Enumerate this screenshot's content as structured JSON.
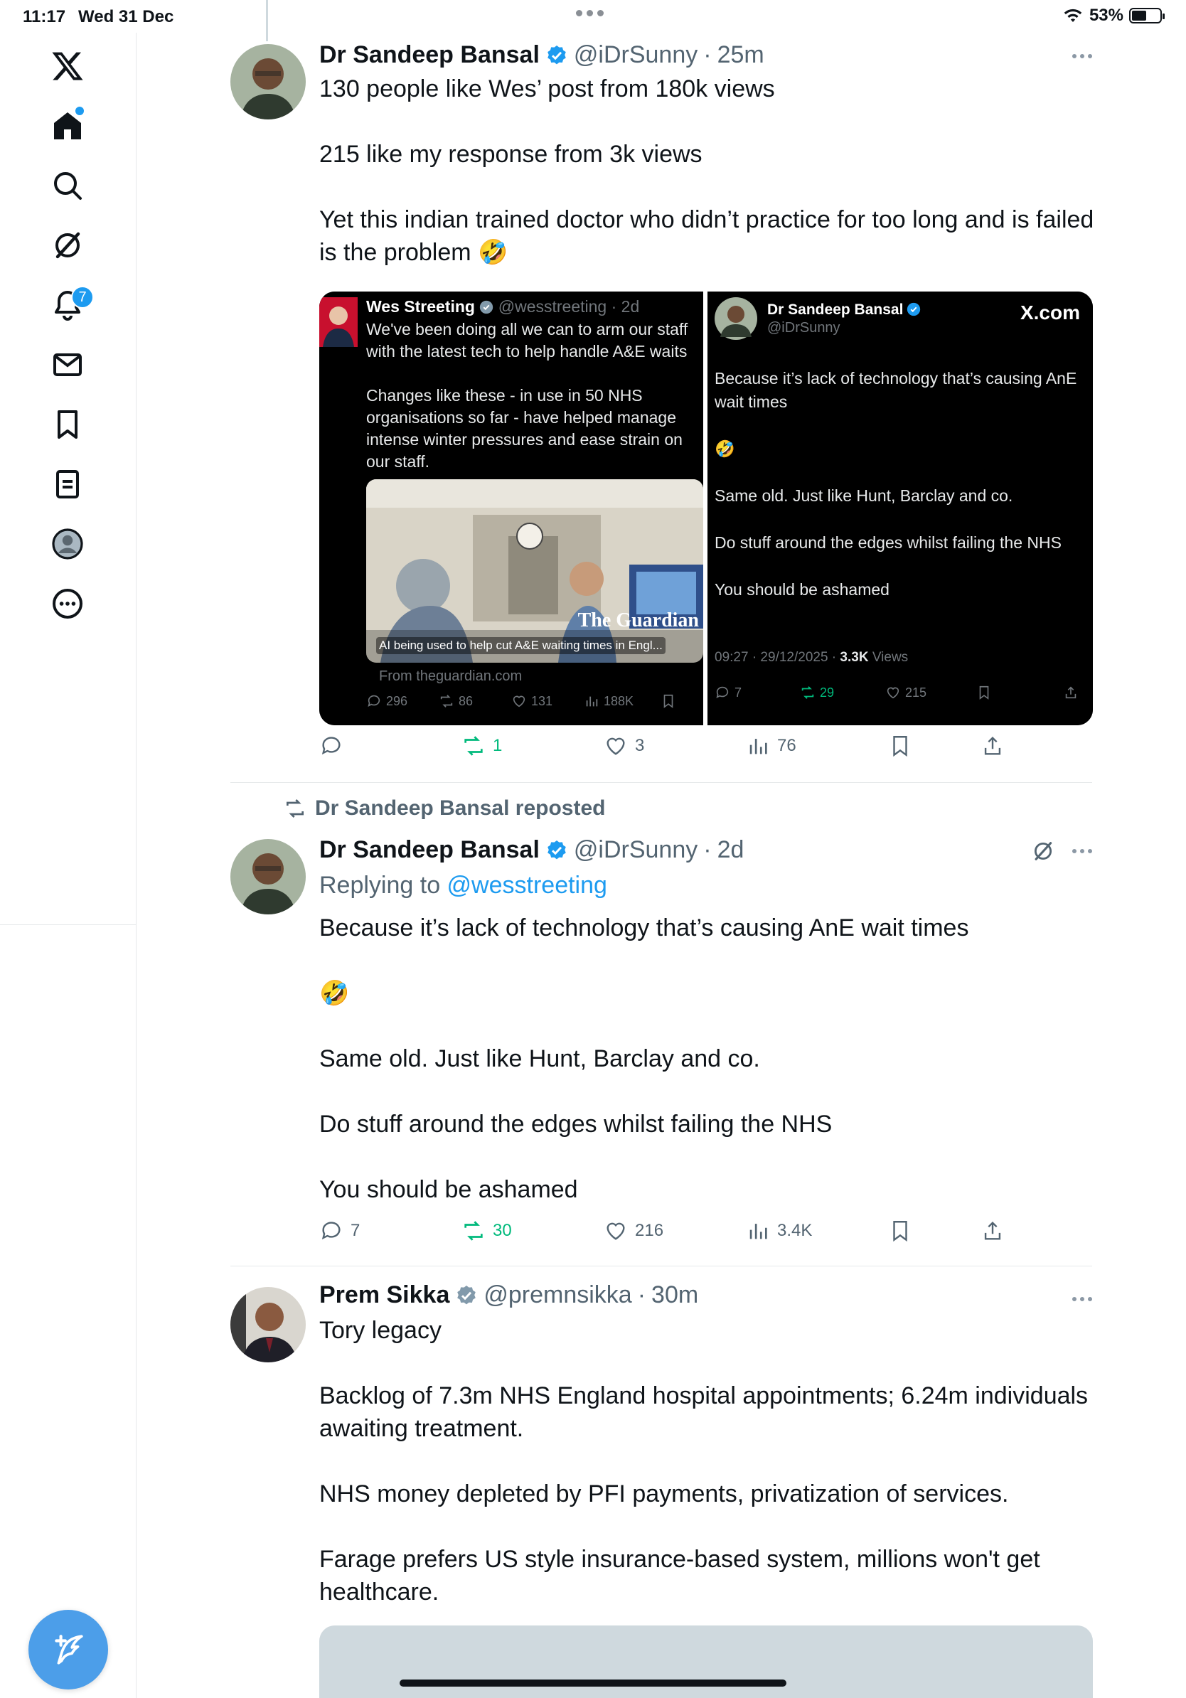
{
  "status_bar": {
    "time": "11:17",
    "date": "Wed 31 Dec",
    "battery": "53%"
  },
  "sidebar": {
    "notifications_badge": "7"
  },
  "posts": [
    {
      "name": "Dr Sandeep Bansal",
      "handle": "@iDrSunny",
      "time": "25m",
      "text": "130 people like Wes’ post from 180k views\n\n215 like my response from 3k views\n\nYet this indian trained doctor who didn’t practice for too long and is failed is the problem 🤣",
      "quote": {
        "left": {
          "name": "Wes Streeting",
          "handle": "@wesstreeting",
          "time": "2d",
          "text": "We've been doing all we can to arm our staff with the latest tech to help handle A&E waits\n\nChanges like these - in use in 50 NHS organisations so far - have helped manage intense winter pressures and ease strain on our staff.",
          "image_caption": "AI being used to help cut A&E waiting times in Engl...",
          "publisher": "The Guardian",
          "source": "From theguardian.com",
          "replies": "296",
          "reposts": "86",
          "likes": "131",
          "views": "188K"
        },
        "right": {
          "name": "Dr Sandeep Bansal",
          "handle": "@iDrSunny",
          "brand": "X.com",
          "text": "Because it’s lack of technology that’s causing AnE wait times\n\n🤣\n\nSame old. Just like Hunt, Barclay and co.\n\nDo stuff around the edges whilst failing the NHS\n\nYou should be ashamed",
          "timestamp": "09:27 · 29/12/2025 · ",
          "views_count": "3.3K",
          "views_label": " Views",
          "replies": "7",
          "reposts": "29",
          "likes": "215"
        }
      },
      "stats": {
        "replies": "",
        "reposts": "1",
        "likes": "3",
        "views": "76"
      }
    },
    {
      "repost_label": "Dr Sandeep Bansal reposted",
      "name": "Dr Sandeep Bansal",
      "handle": "@iDrSunny",
      "time": "2d",
      "replying_prefix": "Replying to ",
      "replying_to": "@wesstreeting",
      "text": "Because it’s lack of technology that’s causing AnE wait times\n\n🤣\n\nSame old. Just like Hunt, Barclay and co.\n\nDo stuff around the edges whilst failing the NHS\n\nYou should be ashamed",
      "stats": {
        "replies": "7",
        "reposts": "30",
        "likes": "216",
        "views": "3.4K"
      }
    },
    {
      "name": "Prem Sikka",
      "handle": "@premnsikka",
      "time": "30m",
      "text": "Tory legacy\n\nBacklog of 7.3m NHS England hospital appointments; 6.24m individuals awaiting treatment.\n\nNHS money depleted by PFI payments, privatization of services.\n\nFarage prefers US style insurance-based system, millions won't get healthcare."
    }
  ],
  "colors": {
    "accent": "#1d9bf0",
    "repost_green": "#00ba7c",
    "secondary_text": "#536471",
    "compose_button": "#4c9ee9"
  }
}
